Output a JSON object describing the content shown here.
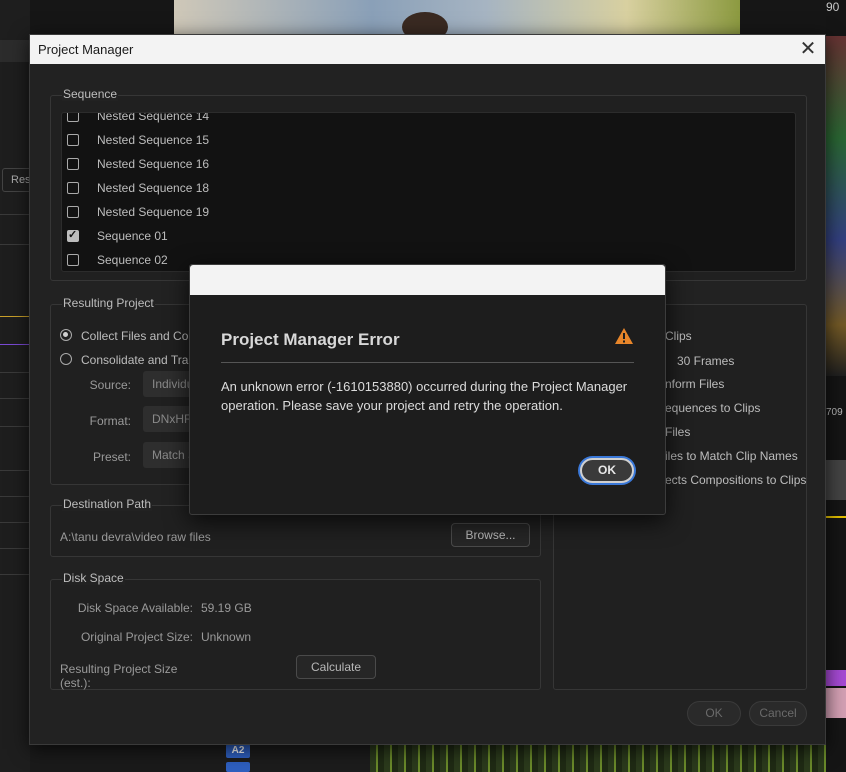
{
  "background": {
    "left_button": "Res",
    "scope_number": "90",
    "timecode_fragment": "709",
    "track_label": "A2"
  },
  "dialog": {
    "title": "Project Manager",
    "close_glyph": "✕",
    "sequence_group": {
      "label": "Sequence",
      "items": [
        {
          "label": "Nested Sequence 14",
          "checked": false
        },
        {
          "label": "Nested Sequence 15",
          "checked": false
        },
        {
          "label": "Nested Sequence 16",
          "checked": false
        },
        {
          "label": "Nested Sequence 18",
          "checked": false
        },
        {
          "label": "Nested Sequence 19",
          "checked": false
        },
        {
          "label": "Sequence 01",
          "checked": true
        },
        {
          "label": "Sequence 02",
          "checked": false
        }
      ]
    },
    "resulting_project": {
      "label": "Resulting Project",
      "option_collect": "Collect Files and Copy",
      "option_consolidate": "Consolidate and Trans",
      "source_label": "Source:",
      "source_value": "Individu",
      "format_label": "Format:",
      "format_value": "DNxHR/",
      "preset_label": "Preset:",
      "preset_value": "Match S"
    },
    "options_panel": {
      "items": [
        "Clips",
        "30 Frames",
        "nform Files",
        "equences to Clips",
        "Files",
        "iles to Match Clip Names",
        "ects Compositions to Clips"
      ]
    },
    "destination": {
      "label": "Destination Path",
      "path": "A:\\tanu devra\\video raw files",
      "browse": "Browse..."
    },
    "disk_space": {
      "label": "Disk Space",
      "available_label": "Disk Space Available:",
      "available_value": "59.19 GB",
      "original_label": "Original Project Size:",
      "original_value": "Unknown",
      "resulting_label": "Resulting Project Size (est.):",
      "calculate": "Calculate"
    },
    "footer": {
      "ok": "OK",
      "cancel": "Cancel"
    }
  },
  "error": {
    "title": "Project Manager Error",
    "message": "An unknown error (-1610153880) occurred during the Project Manager operation. Please save your project and retry the operation.",
    "ok": "OK",
    "warning_color": "#e8862a"
  }
}
